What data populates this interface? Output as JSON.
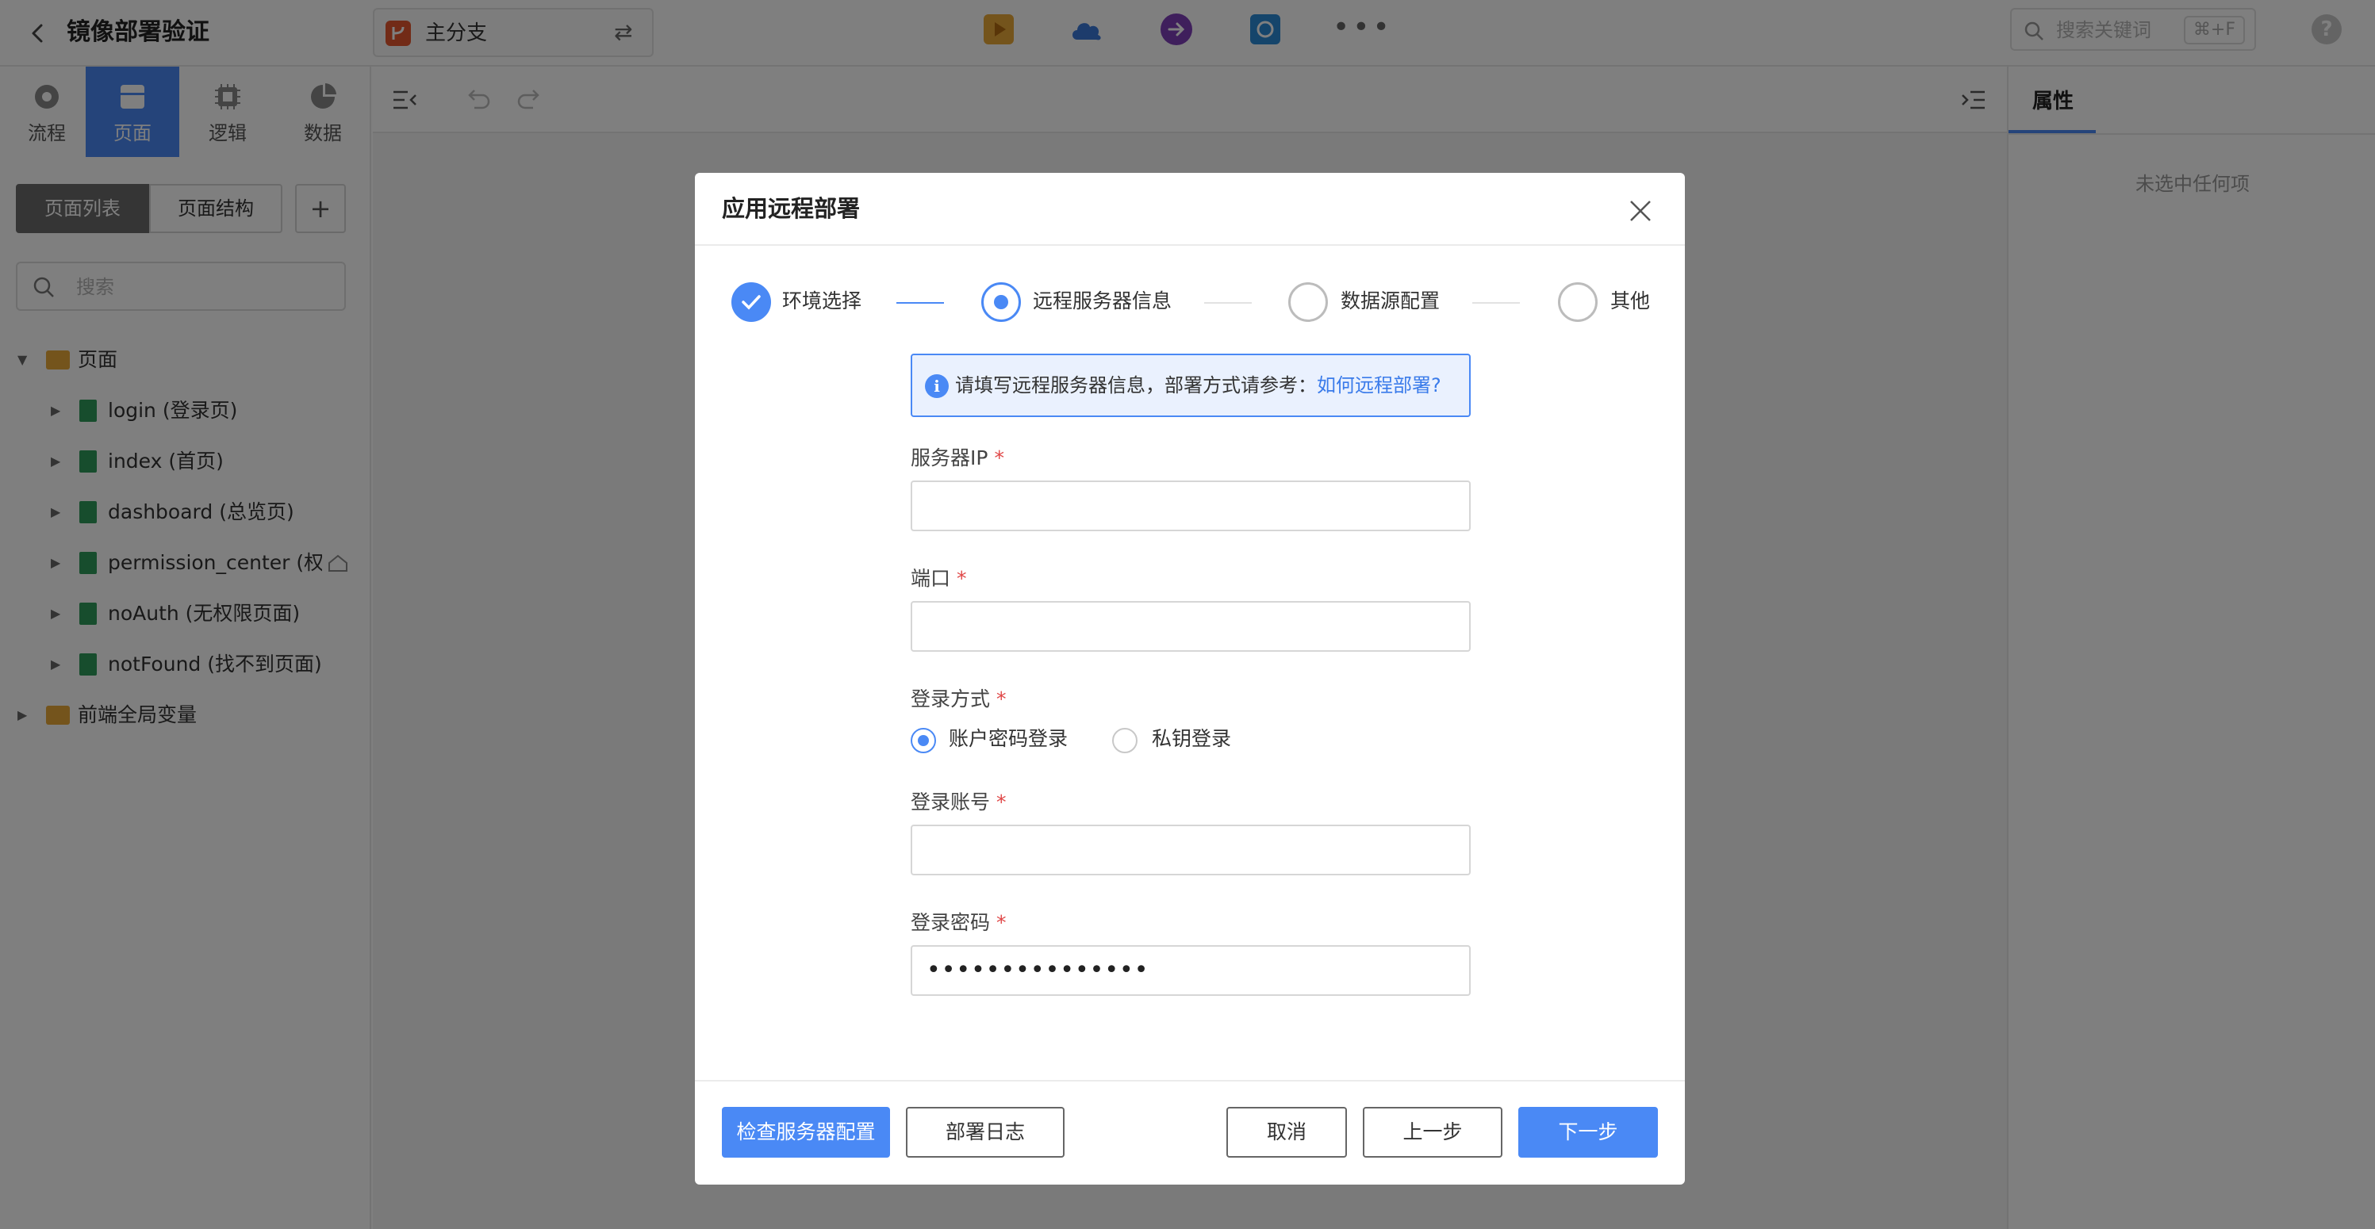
{
  "topbar": {
    "title": "镜像部署验证",
    "branch": "主分支",
    "search_placeholder": "搜索关键词",
    "search_shortcut": "⌘+F",
    "help": "?",
    "tool_colors": [
      "#e8a838",
      "#3a78d8",
      "#7e3fb8",
      "#2a8ad6"
    ]
  },
  "sidebar": {
    "mode_tabs": [
      {
        "label": "流程",
        "icon": "process-icon"
      },
      {
        "label": "页面",
        "icon": "page-icon",
        "active": true
      },
      {
        "label": "逻辑",
        "icon": "logic-icon"
      },
      {
        "label": "数据",
        "icon": "data-icon"
      }
    ],
    "segments": [
      "页面列表",
      "页面结构"
    ],
    "add_label": "+",
    "search_placeholder": "搜索",
    "tree": [
      {
        "label": "页面",
        "type": "folder",
        "expanded": true
      },
      {
        "label": "login (登录页)",
        "type": "page"
      },
      {
        "label": "index (首页)",
        "type": "page"
      },
      {
        "label": "dashboard (总览页)",
        "type": "page"
      },
      {
        "label": "permission_center (权限中心)",
        "type": "page"
      },
      {
        "label": "noAuth (无权限页面)",
        "type": "page"
      },
      {
        "label": "notFound (找不到页面)",
        "type": "page"
      },
      {
        "label": "前端全局变量",
        "type": "folder",
        "expanded": false
      }
    ]
  },
  "right_panel": {
    "tab": "属性",
    "empty_text": "未选中任何项"
  },
  "modal": {
    "title": "应用远程部署",
    "steps": [
      {
        "label": "环境选择",
        "state": "done"
      },
      {
        "label": "远程服务器信息",
        "state": "current"
      },
      {
        "label": "数据源配置",
        "state": "pending"
      },
      {
        "label": "其他",
        "state": "pending"
      }
    ],
    "info_text": "请填写远程服务器信息，部署方式请参考：",
    "info_link": "如何远程部署?",
    "fields": {
      "server_ip": {
        "label": "服务器IP",
        "value": ""
      },
      "port": {
        "label": "端口",
        "value": ""
      },
      "login_method": {
        "label": "登录方式",
        "options": [
          "账户密码登录",
          "私钥登录"
        ],
        "selected": "账户密码登录"
      },
      "account": {
        "label": "登录账号",
        "value": ""
      },
      "password": {
        "label": "登录密码",
        "value": "•••••••••••••••"
      }
    },
    "required_mark": "*",
    "buttons": {
      "check": "检查服务器配置",
      "log": "部署日志",
      "cancel": "取消",
      "prev": "上一步",
      "next": "下一步"
    }
  },
  "colors": {
    "accent": "#4a89f5",
    "required": "#e04848"
  }
}
